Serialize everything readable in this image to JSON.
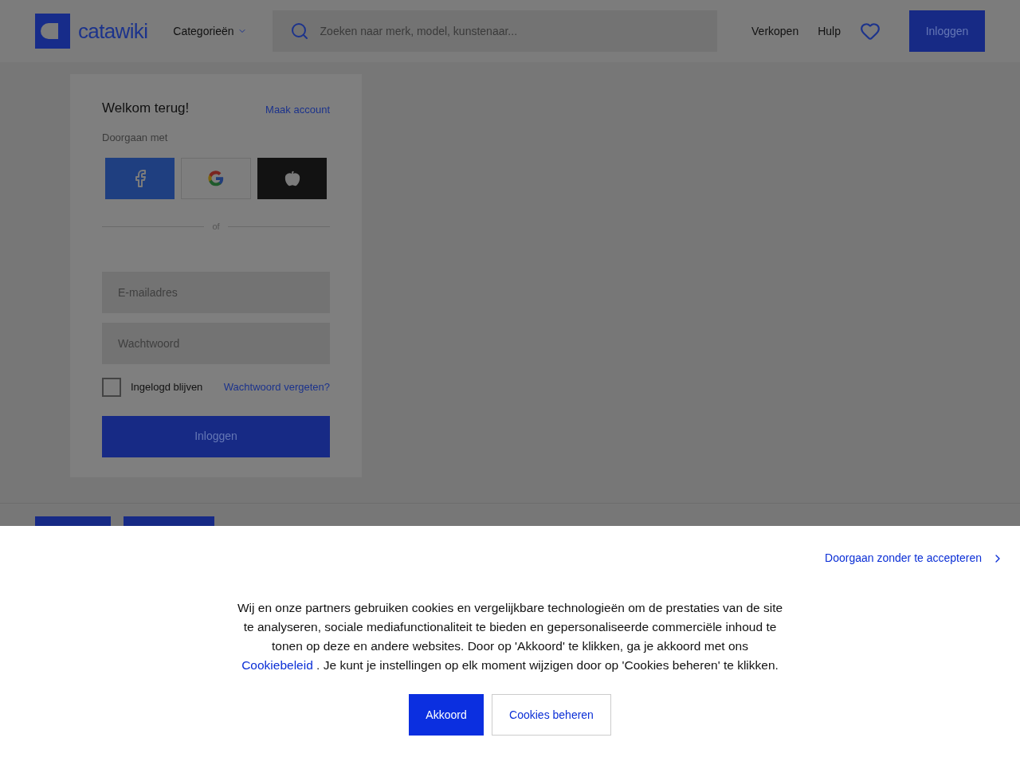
{
  "header": {
    "logo_text": "catawiki",
    "categories": "Categorieën",
    "search": {
      "placeholder": "Zoeken naar merk, model, kunstenaar..."
    },
    "nav": [
      "Verkopen",
      "Hulp"
    ],
    "login_button": "Inloggen"
  },
  "login": {
    "title": "Welkom terug!",
    "create_account": "Maak account",
    "continue_with": "Doorgaan met",
    "social": [
      {
        "kind": "facebook"
      },
      {
        "kind": "google"
      },
      {
        "kind": "apple"
      }
    ],
    "divider": "of",
    "email": {
      "placeholder": "E-mailadres"
    },
    "password": {
      "placeholder": "Wachtwoord"
    },
    "remember": {
      "label": "Ingelogd blijven",
      "checked": false
    },
    "forgot": "Wachtwoord vergeten?",
    "submit": "Inloggen"
  },
  "cookie_banner": {
    "skip": "Doorgaan zonder te accepteren",
    "text_before": "Wij en onze partners gebruiken cookies en vergelijkbare technologieën om de prestaties van de site te analyseren, sociale mediafunctionaliteit te bieden en gepersonaliseerde commerciële inhoud te tonen op deze en andere websites. Door op 'Akkoord' te klikken, ga je akkoord met ons",
    "link": "Cookiebeleid",
    "text_after": ". Je kunt je instellingen op elk moment wijzigen door op 'Cookies beheren' te klikken.",
    "accept": "Akkoord",
    "manage": "Cookies beheren"
  }
}
